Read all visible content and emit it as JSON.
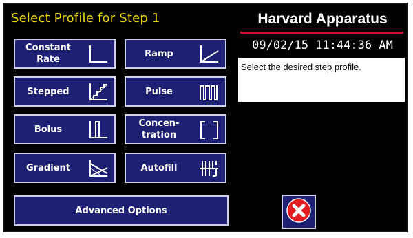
{
  "header": {
    "title": "Select Profile for Step 1",
    "brand": "Harvard Apparatus",
    "datetime": "09/02/15 11:44:36 AM"
  },
  "message": "Select the desired step profile.",
  "profiles": [
    {
      "label_line1": "Constant",
      "label_line2": "Rate",
      "icon": "constant-rate-icon"
    },
    {
      "label_line1": "Ramp",
      "label_line2": "",
      "icon": "ramp-icon"
    },
    {
      "label_line1": "Stepped",
      "label_line2": "",
      "icon": "stepped-icon"
    },
    {
      "label_line1": "Pulse",
      "label_line2": "",
      "icon": "pulse-icon"
    },
    {
      "label_line1": "Bolus",
      "label_line2": "",
      "icon": "bolus-icon"
    },
    {
      "label_line1": "Concen-",
      "label_line2": "tration",
      "icon": "concentration-icon"
    },
    {
      "label_line1": "Gradient",
      "label_line2": "",
      "icon": "gradient-icon"
    },
    {
      "label_line1": "Autofill",
      "label_line2": "",
      "icon": "autofill-icon"
    }
  ],
  "advanced_label": "Advanced Options",
  "close_icon": "close-icon",
  "colors": {
    "title": "#e8d800",
    "button_bg": "#1e2074",
    "brand_line": "#c8102e",
    "close_red": "#e21b23"
  }
}
